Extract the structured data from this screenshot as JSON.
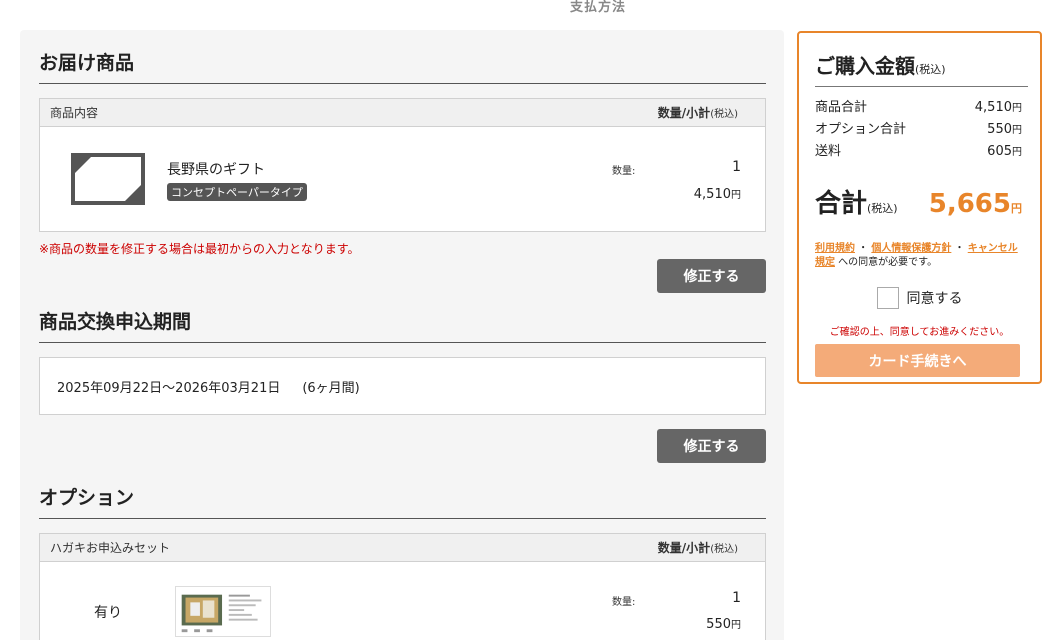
{
  "header": {
    "step_label": "支払方法"
  },
  "delivery": {
    "title": "お届け商品",
    "head_left": "商品内容",
    "head_right": "数量/小計",
    "tax_note": "(税込)",
    "item": {
      "name": "長野県のギフト",
      "badge": "コンセプトペーパータイプ",
      "qty_label": "数量:",
      "qty": "1",
      "price": "4,510",
      "yen": "円"
    },
    "note": "※商品の数量を修正する場合は最初からの入力となります。",
    "edit_label": "修正する"
  },
  "period": {
    "title": "商品交換申込期間",
    "range": "2025年09月22日～2026年03月21日",
    "months": "(6ヶ月間)",
    "edit_label": "修正する"
  },
  "options": {
    "title": "オプション",
    "head_left": "ハガキお申込みセット",
    "head_right": "数量/小計",
    "tax_note": "(税込)",
    "item": {
      "value": "有り",
      "qty_label": "数量:",
      "qty": "1",
      "price": "550",
      "yen": "円"
    }
  },
  "summary": {
    "title": "ご購入金額",
    "tax_note": "(税込)",
    "lines": [
      {
        "label": "商品合計",
        "value": "4,510",
        "yen": "円"
      },
      {
        "label": "オプション合計",
        "value": "550",
        "yen": "円"
      },
      {
        "label": "送料",
        "value": "605",
        "yen": "円"
      }
    ],
    "total_label": "合計",
    "total_tax_note": "(税込)",
    "total_value": "5,665",
    "total_yen": "円",
    "terms_link1": "利用規約",
    "terms_sep1": " ・ ",
    "terms_link2": "個人情報保護方針",
    "terms_sep2": " ・ ",
    "terms_link3": "キャンセル規定",
    "terms_suffix": " への同意が必要です。",
    "agree_label": "同意する",
    "confirm_note": "ご確認の上、同意してお進みください。",
    "card_button": "カード手続きへ"
  },
  "colors": {
    "accent": "#e8852a",
    "warning": "#cc0000",
    "button_gray": "#666666",
    "button_disabled": "#f4ab79"
  }
}
